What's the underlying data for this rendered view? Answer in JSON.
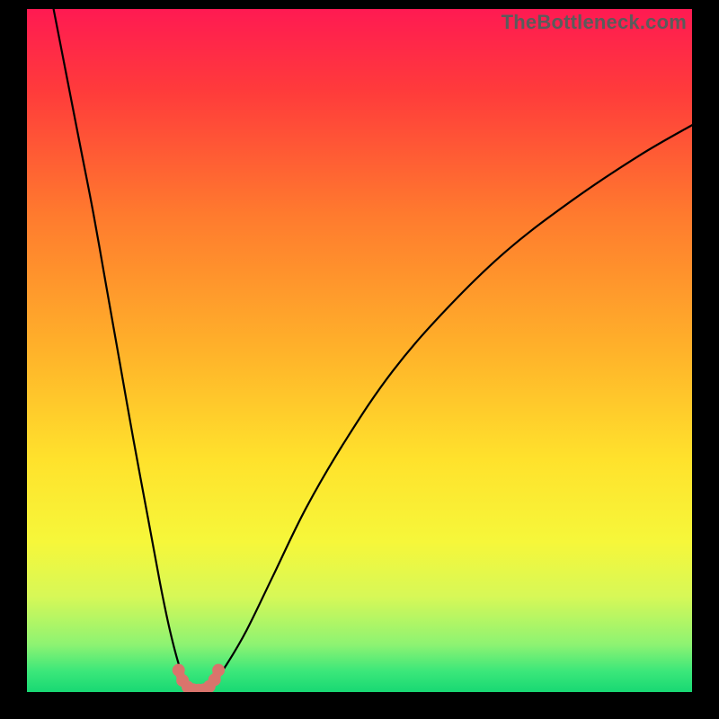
{
  "watermark": "TheBottleneck.com",
  "chart_data": {
    "type": "line",
    "title": "",
    "xlabel": "",
    "ylabel": "",
    "xlim": [
      0,
      100
    ],
    "ylim": [
      0,
      100
    ],
    "grid": false,
    "legend": false,
    "background_gradient": {
      "stops": [
        {
          "offset": 0.0,
          "color": "#ff1a52"
        },
        {
          "offset": 0.12,
          "color": "#ff3b3b"
        },
        {
          "offset": 0.3,
          "color": "#ff7a2e"
        },
        {
          "offset": 0.5,
          "color": "#ffb22a"
        },
        {
          "offset": 0.66,
          "color": "#ffe22c"
        },
        {
          "offset": 0.78,
          "color": "#f6f73a"
        },
        {
          "offset": 0.86,
          "color": "#d7f857"
        },
        {
          "offset": 0.93,
          "color": "#8ef372"
        },
        {
          "offset": 0.97,
          "color": "#3be77a"
        },
        {
          "offset": 1.0,
          "color": "#18d873"
        }
      ]
    },
    "series": [
      {
        "name": "left-branch",
        "x": [
          4,
          6,
          8,
          10,
          12,
          14,
          16,
          18,
          20,
          21.5,
          23,
          24,
          25
        ],
        "y": [
          100,
          90,
          80,
          70,
          59,
          48,
          37,
          26.5,
          16,
          9,
          3.5,
          1.3,
          0.5
        ]
      },
      {
        "name": "right-branch",
        "x": [
          27,
          28,
          30,
          33,
          37,
          42,
          48,
          55,
          63,
          72,
          82,
          92,
          100
        ],
        "y": [
          0.5,
          1.3,
          4,
          9,
          17,
          27,
          37,
          47,
          56,
          64.5,
          72,
          78.5,
          83
        ]
      }
    ],
    "markers": {
      "name": "valley-markers",
      "color": "#d9746c",
      "points": [
        {
          "x": 22.8,
          "y": 3.2
        },
        {
          "x": 23.4,
          "y": 1.7
        },
        {
          "x": 24.2,
          "y": 0.7
        },
        {
          "x": 25.0,
          "y": 0.35
        },
        {
          "x": 25.8,
          "y": 0.3
        },
        {
          "x": 26.6,
          "y": 0.35
        },
        {
          "x": 27.4,
          "y": 0.8
        },
        {
          "x": 28.2,
          "y": 1.8
        },
        {
          "x": 28.8,
          "y": 3.2
        }
      ]
    }
  }
}
